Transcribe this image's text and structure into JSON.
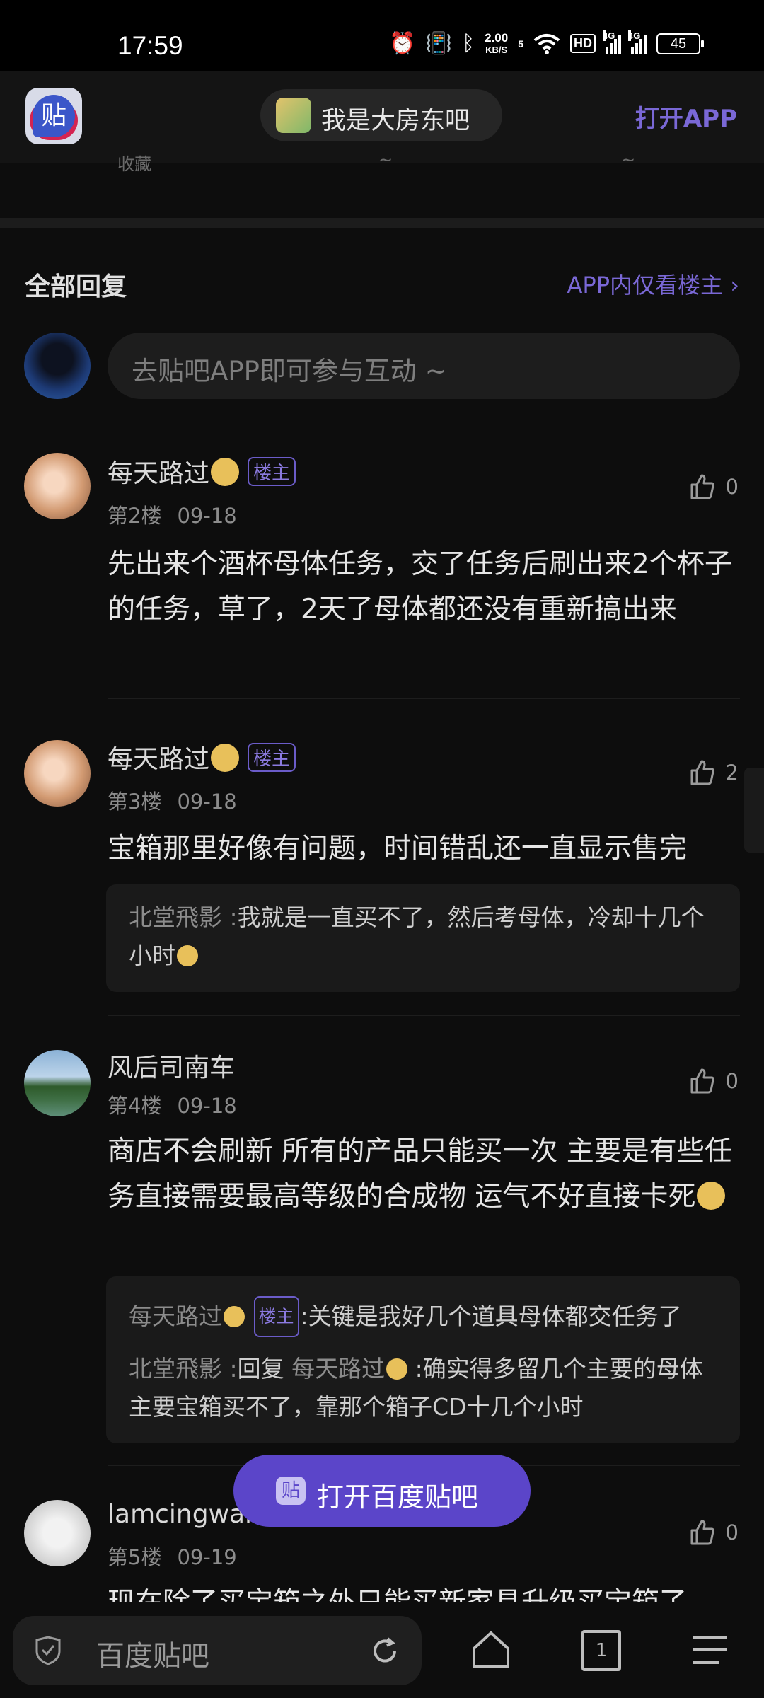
{
  "status": {
    "time": "17:59",
    "net_speed_top": "2.00",
    "net_speed_unit": "KB/S",
    "sim_number": "5",
    "hd_label": "HD",
    "net1": "4G",
    "net2": "4G",
    "battery": "45"
  },
  "header": {
    "forum_name": "我是大房东吧",
    "open_app": "打开APP",
    "logo_glyph": "贴"
  },
  "cut_texts": [
    "收藏",
    "~",
    "~"
  ],
  "replies_header": {
    "title": "全部回复",
    "only_op": "APP内仅看楼主 ›"
  },
  "reply_input": {
    "placeholder": "去贴吧APP即可参与互动 ~"
  },
  "posts": [
    {
      "user": "每天路过",
      "op_badge": "楼主",
      "floor": "第2楼",
      "date": "09-18",
      "likes": "0",
      "content": "先出来个酒杯母体任务，交了任务后刷出来2个杯子的任务，草了，2天了母体都还没有重新搞出来"
    },
    {
      "user": "每天路过",
      "op_badge": "楼主",
      "floor": "第3楼",
      "date": "09-18",
      "likes": "2",
      "content": "宝箱那里好像有问题，时间错乱还一直显示售完",
      "sub": [
        {
          "name": "北堂飛影",
          "sep": " :",
          "text": "我就是一直买不了，然后考母体，冷却十几个小时"
        }
      ]
    },
    {
      "user": "风后司南车",
      "floor": "第4楼",
      "date": "09-18",
      "likes": "0",
      "content": "商店不会刷新 所有的产品只能买一次 主要是有些任务直接需要最高等级的合成物 运气不好直接卡死",
      "sub": [
        {
          "name": "每天路过",
          "badge": "楼主",
          "sep": ":",
          "text": "关键是我好几个道具母体都交任务了"
        },
        {
          "name": "北堂飛影",
          "sep": " :",
          "reply_word": "回复 ",
          "reply_to": "每天路过",
          "text": " :确实得多留几个主要的母体 主要宝箱买不了，靠那个箱子CD十几个小时"
        }
      ]
    },
    {
      "user": "lamcingwan",
      "floor": "第5楼",
      "date": "09-19",
      "likes": "0",
      "content": "现在除了买宝箱之外只能买新家具升级买宝箱了"
    }
  ],
  "floating_button": {
    "label": "打开百度贴吧",
    "logo_glyph": "贴"
  },
  "bottom_bar": {
    "site": "百度贴吧",
    "tabs_count": "1"
  },
  "colors": {
    "accent": "#7a68d6",
    "button": "#5b45c9",
    "background": "#0d0d0d"
  }
}
